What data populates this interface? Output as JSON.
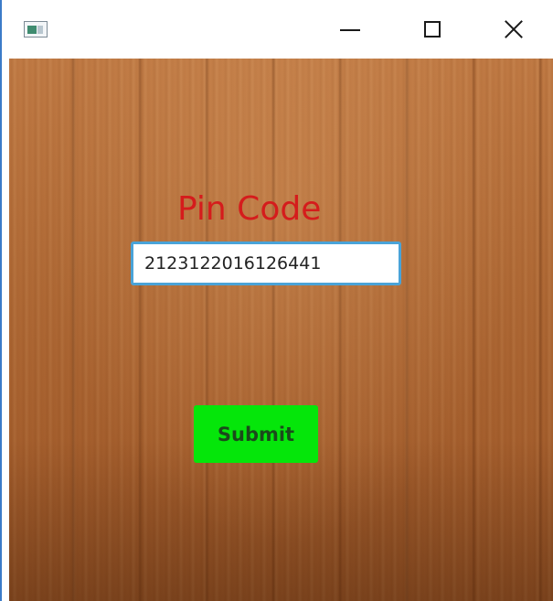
{
  "window": {
    "controls": {
      "minimize_icon": "minimize-icon",
      "maximize_icon": "maximize-icon",
      "close_icon": "close-icon"
    }
  },
  "form": {
    "pin_label": "Pin Code",
    "pin_value": "2123122016126441",
    "submit_label": "Submit"
  },
  "colors": {
    "label": "#d51c1c",
    "submit_background": "#05e60a",
    "input_focus_border": "#4aa3d8",
    "background_wood": "#b06a36"
  }
}
